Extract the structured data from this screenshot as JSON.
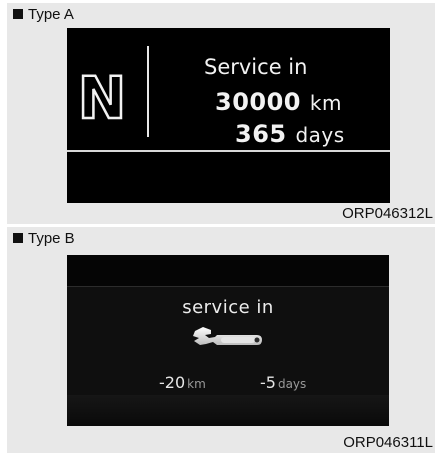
{
  "type_a": {
    "label": "Type A",
    "gear": "N",
    "service_title": "Service in",
    "distance_value": "30000",
    "distance_unit": "km",
    "days_value": "365",
    "days_unit": "days",
    "code": "ORP046312L"
  },
  "type_b": {
    "label": "Type B",
    "service_title": "service in",
    "icon": "wrench-icon",
    "distance_value": "-20",
    "distance_unit": "km",
    "days_value": "-5",
    "days_unit": "days",
    "code": "ORP046311L"
  }
}
